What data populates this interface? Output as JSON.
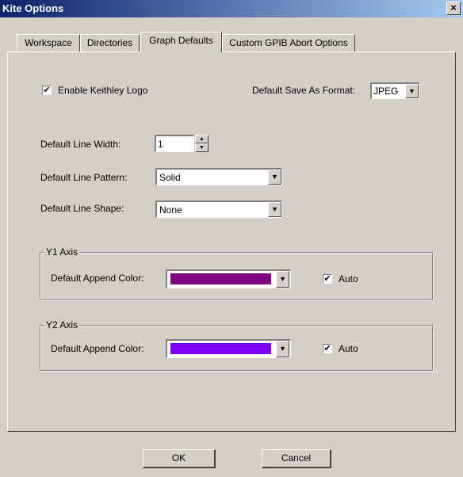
{
  "window": {
    "title": "Kite Options",
    "close_glyph": "×"
  },
  "tabs": [
    {
      "label": "Workspace"
    },
    {
      "label": "Directories"
    },
    {
      "label": "Graph Defaults",
      "active": true
    },
    {
      "label": "Custom GPIB Abort Options"
    }
  ],
  "graph_defaults": {
    "enable_logo_label": "Enable Keithley Logo",
    "enable_logo_checked": true,
    "save_format_label": "Default Save As Format:",
    "save_format_value": "JPEG",
    "line_width_label": "Default Line Width:",
    "line_width_value": "1",
    "line_pattern_label": "Default Line Pattern:",
    "line_pattern_value": "Solid",
    "line_shape_label": "Default Line Shape:",
    "line_shape_value": "None"
  },
  "y1_axis": {
    "group_label": "Y1 Axis",
    "append_color_label": "Default Append Color:",
    "color": "#800080",
    "auto_label": "Auto",
    "auto_checked": true
  },
  "y2_axis": {
    "group_label": "Y2 Axis",
    "append_color_label": "Default Append Color:",
    "color": "#8000ff",
    "auto_label": "Auto",
    "auto_checked": true
  },
  "buttons": {
    "ok": "OK",
    "cancel": "Cancel"
  },
  "glyphs": {
    "check": "✔",
    "dropdown_arrow": "▼",
    "spin_up": "▲",
    "spin_down": "▼"
  }
}
